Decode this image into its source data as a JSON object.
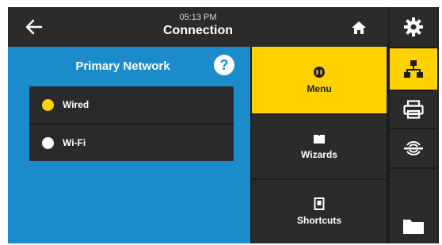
{
  "header": {
    "time": "05:13 PM",
    "title": "Connection"
  },
  "left_panel": {
    "title": "Primary Network",
    "help_label": "?",
    "options": [
      {
        "label": "Wired",
        "selected": true
      },
      {
        "label": "Wi-Fi",
        "selected": false
      }
    ]
  },
  "menu": {
    "items": [
      {
        "label": "Menu",
        "icon": "menu-icon",
        "active": true
      },
      {
        "label": "Wizards",
        "icon": "book-icon",
        "active": false
      },
      {
        "label": "Shortcuts",
        "icon": "bookmark-icon",
        "active": false
      }
    ]
  },
  "sidebar": {
    "items": [
      {
        "icon": "gear-icon"
      },
      {
        "icon": "network-icon",
        "active": true
      },
      {
        "icon": "printer-icon"
      },
      {
        "icon": "sensor-icon"
      },
      {
        "icon": "folder-icon"
      }
    ]
  },
  "colors": {
    "accent": "#ffd200",
    "panel_blue": "#1a8bcb",
    "dark": "#2b2b2b",
    "selected_radio": "#ffd200",
    "unselected_radio": "#ffffff"
  }
}
